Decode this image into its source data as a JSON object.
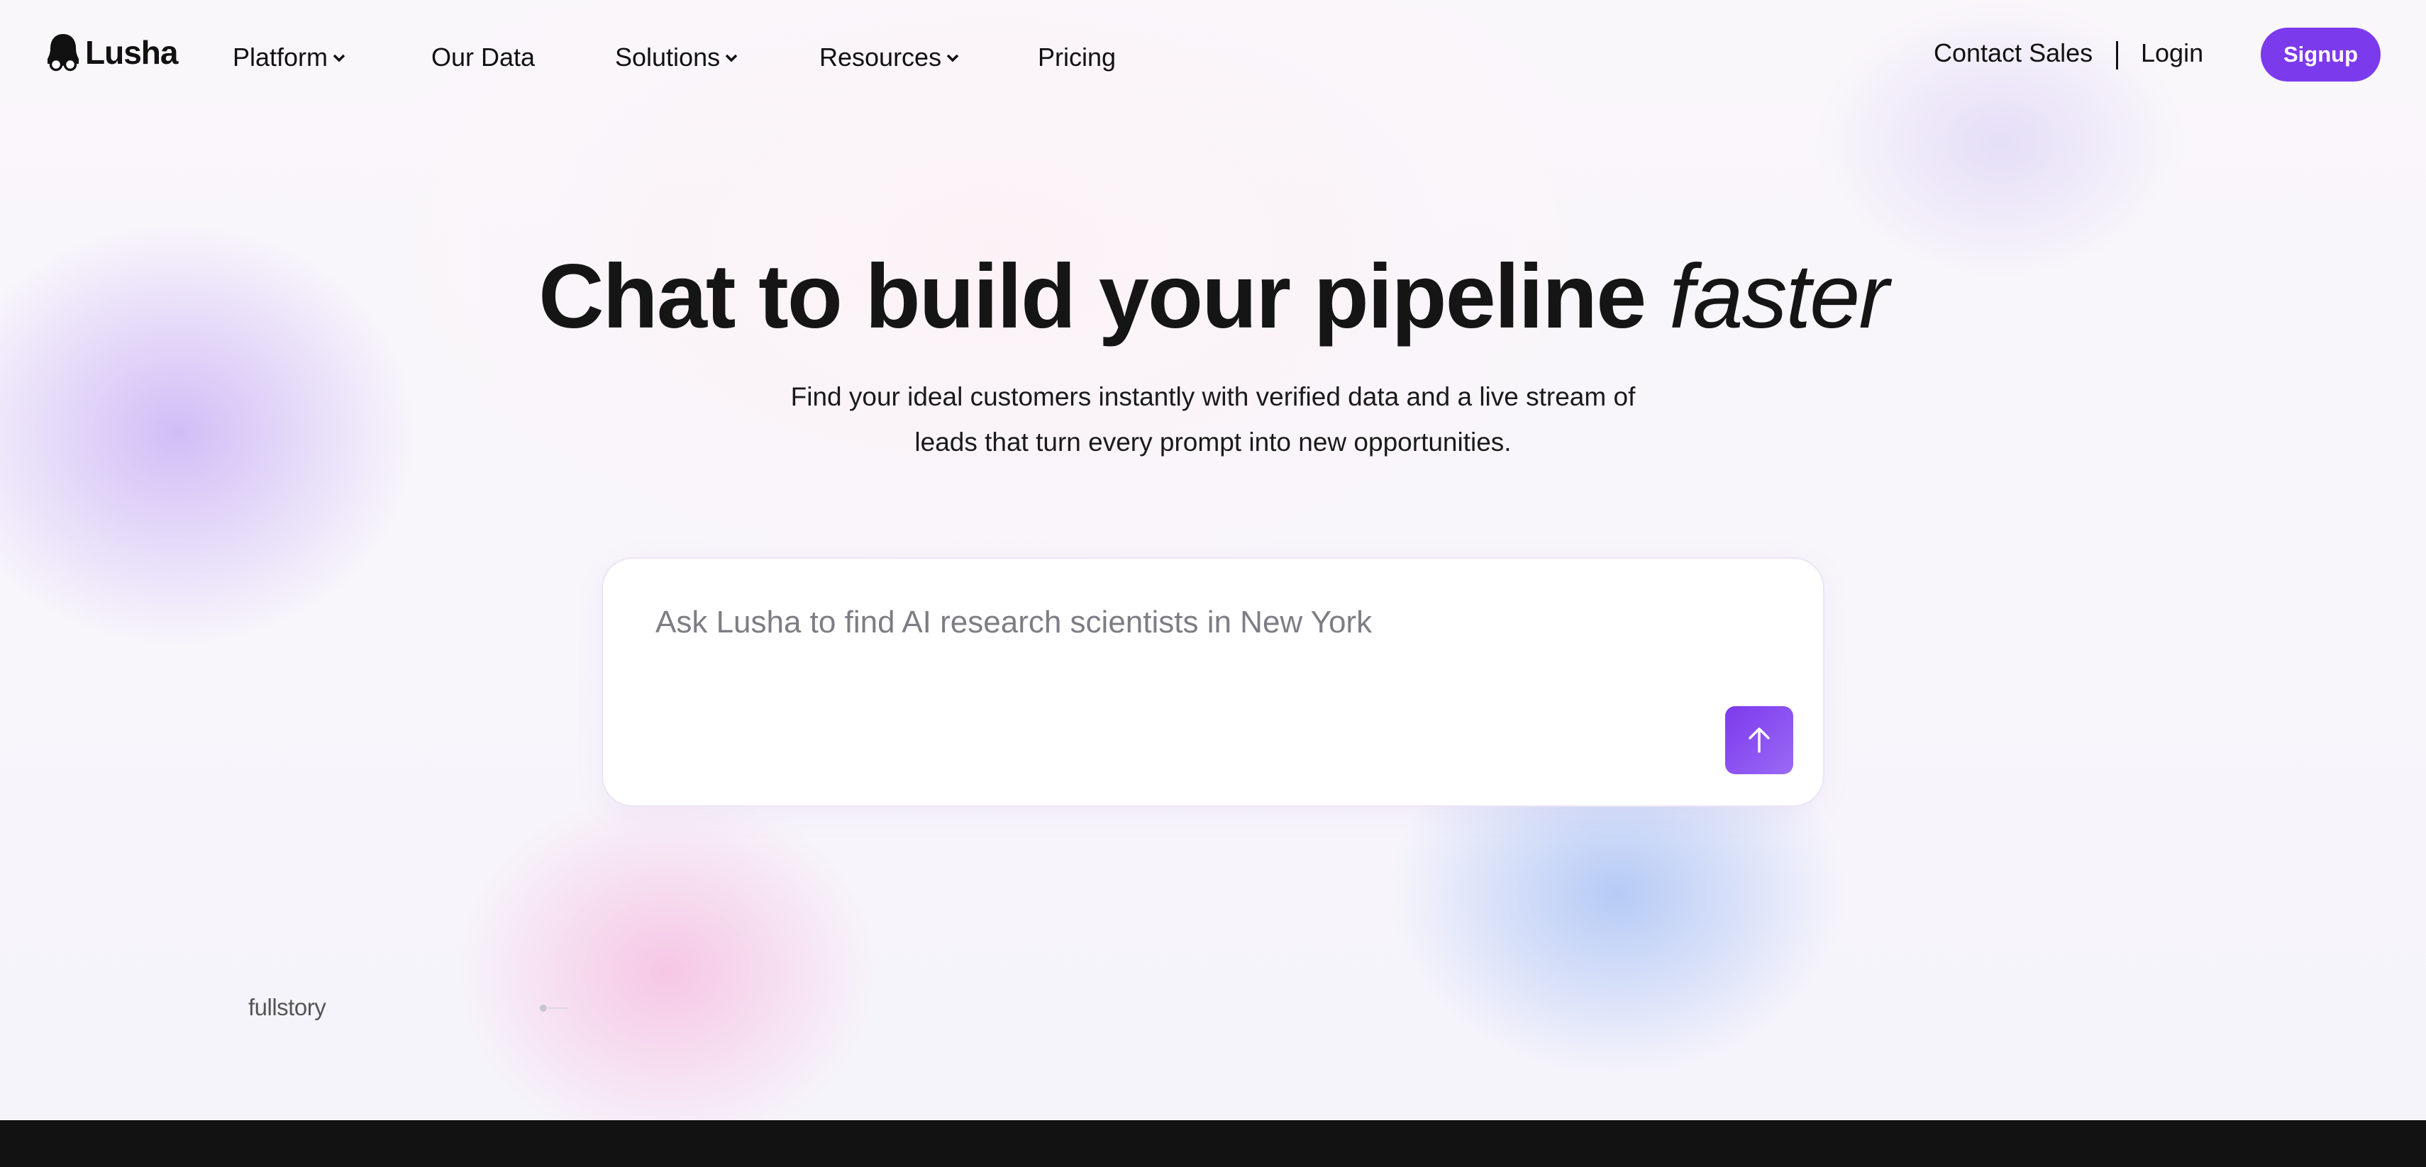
{
  "brand": {
    "name": "Lusha",
    "accent": "#7c3aed"
  },
  "nav": {
    "items": [
      {
        "label": "Platform",
        "dropdown": true
      },
      {
        "label": "Our Data",
        "dropdown": false
      },
      {
        "label": "Solutions",
        "dropdown": true
      },
      {
        "label": "Resources",
        "dropdown": true
      },
      {
        "label": "Pricing",
        "dropdown": false
      }
    ],
    "contact_sales": "Contact Sales",
    "login": "Login",
    "signup": "Signup"
  },
  "hero": {
    "headline": "Chat to build your pipeline ",
    "headline_italic": "faster",
    "subtitle_line1": "Find your ideal customers instantly with verified data and a live stream of",
    "subtitle_line2": "leads that turn every prompt into new opportunities."
  },
  "chat": {
    "placeholder": "Ask Lusha to find AI research scientists in New York",
    "value": "",
    "send_icon": "arrow-up-icon"
  },
  "logos": {
    "items": [
      "fullstory"
    ]
  }
}
